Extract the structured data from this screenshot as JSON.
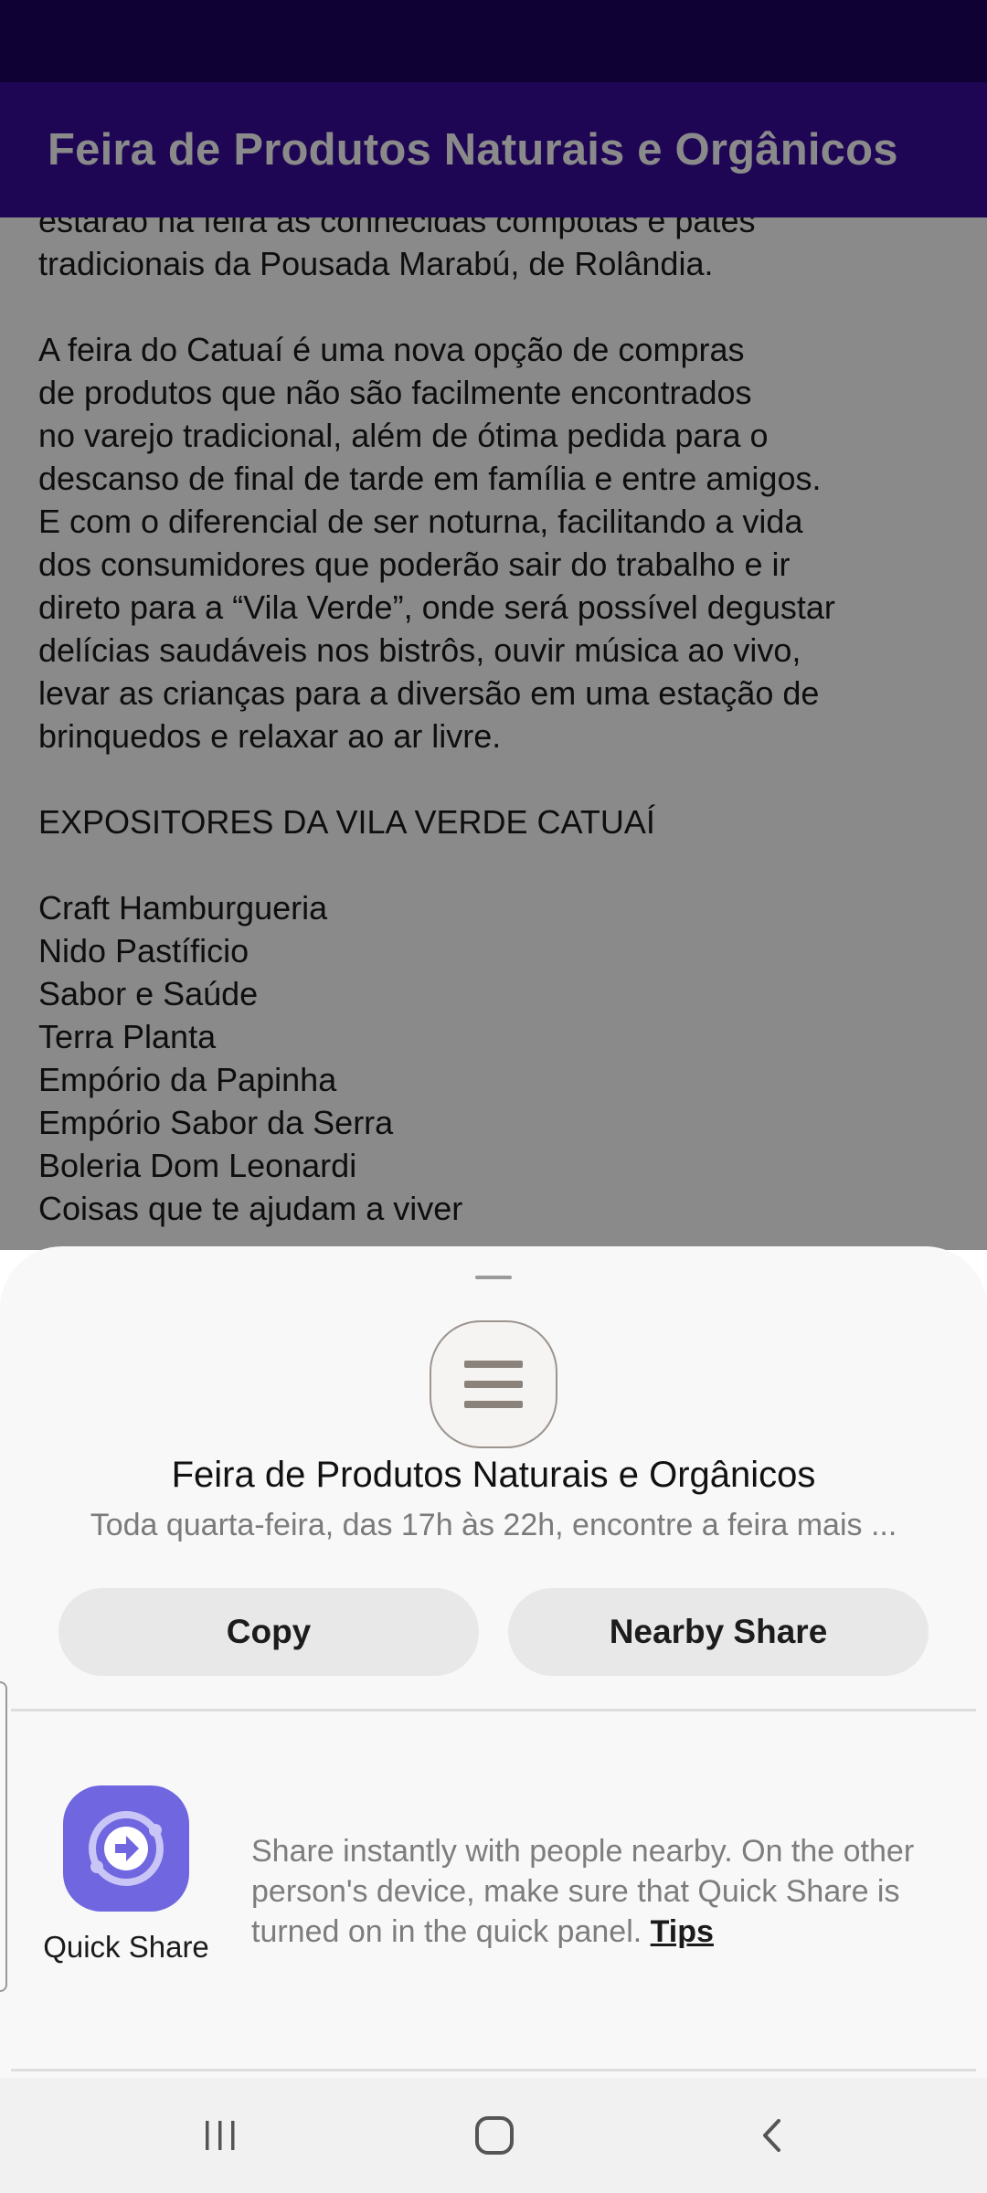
{
  "app_bar": {
    "title": "Feira de Produtos Naturais e Orgânicos"
  },
  "article": {
    "paragraph1_lines": [
      "estarão na feira as conhecidas compotas e patês",
      "tradicionais da Pousada Marabú, de Rolândia."
    ],
    "paragraph2_lines": [
      "A feira do Catuaí é uma nova opção de compras",
      "de produtos que não são facilmente encontrados",
      "no varejo tradicional, além de ótima pedida para o",
      "descanso de final de tarde em família e entre amigos.",
      "E com o diferencial de ser noturna, facilitando a vida",
      "dos consumidores que poderão sair do trabalho e ir",
      "direto para a “Vila Verde”, onde será possível degustar",
      "delícias saudáveis nos bistrôs, ouvir música ao vivo,",
      "levar as crianças para a diversão em uma estação de",
      "brinquedos e relaxar ao ar livre."
    ],
    "heading": "EXPOSITORES DA VILA VERDE CATUAÍ",
    "exhibitors": [
      "Craft Hamburgueria",
      "Nido Pastíficio",
      "Sabor e Saúde",
      "Terra Planta",
      "Empório da Papinha",
      "Empório Sabor da Serra",
      "Boleria Dom Leonardi",
      "Coisas que te ajudam a viver"
    ]
  },
  "share_sheet": {
    "icon": "menu-lines-icon",
    "title": "Feira de Produtos Naturais e Orgânicos",
    "description": "Toda quarta-feira, das 17h às 22h, encontre a feira mais ...",
    "copy_label": "Copy",
    "nearby_label": "Nearby Share",
    "quick_share": {
      "label": "Quick Share",
      "text": "Share instantly with people nearby. On the other person's device, make sure that Quick Share is turned on in the quick panel.",
      "tips_label": "Tips",
      "icon_color": "#6f66e0"
    }
  },
  "colors": {
    "status_bar": "#1d0360",
    "app_bar": "#3a0c9e"
  },
  "nav": {
    "recent": "recent-apps-icon",
    "home": "home-icon",
    "back": "back-icon"
  }
}
